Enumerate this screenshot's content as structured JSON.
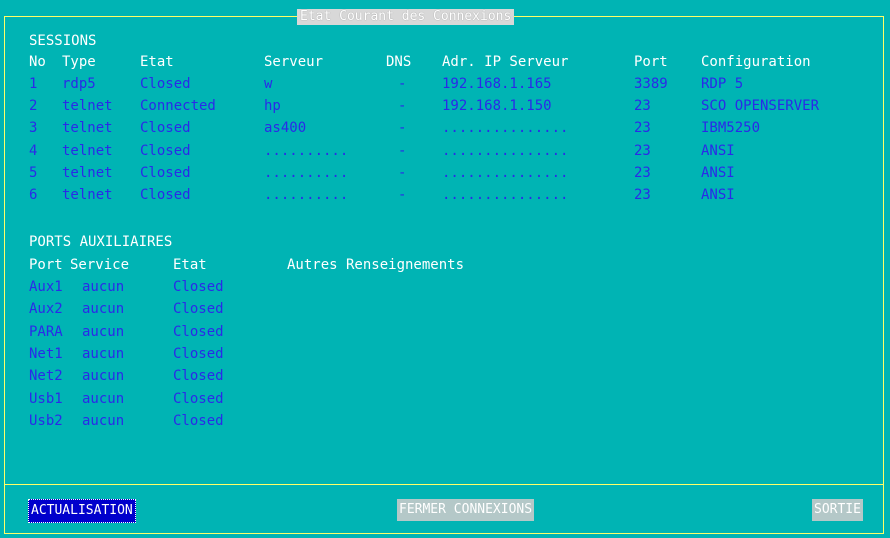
{
  "window": {
    "title": "Etat Courant des Connexions"
  },
  "sessions": {
    "heading": "SESSIONS",
    "headers": {
      "no": "No",
      "type": "Type",
      "etat": "Etat",
      "serveur": "Serveur",
      "dns": "DNS",
      "ip": "Adr. IP Serveur",
      "port": "Port",
      "config": "Configuration"
    },
    "rows": [
      {
        "no": "1",
        "type": "rdp5",
        "etat": "Closed",
        "serveur": "w",
        "dns": "-",
        "ip": "192.168.1.165",
        "port": "3389",
        "config": "RDP 5"
      },
      {
        "no": "2",
        "type": "telnet",
        "etat": "Connected",
        "serveur": "hp",
        "dns": "-",
        "ip": "192.168.1.150",
        "port": "23",
        "config": "SCO OPENSERVER"
      },
      {
        "no": "3",
        "type": "telnet",
        "etat": "Closed",
        "serveur": "as400",
        "dns": "-",
        "ip": "...............",
        "port": "23",
        "config": "IBM5250"
      },
      {
        "no": "4",
        "type": "telnet",
        "etat": "Closed",
        "serveur": "..........",
        "dns": "-",
        "ip": "...............",
        "port": "23",
        "config": "ANSI"
      },
      {
        "no": "5",
        "type": "telnet",
        "etat": "Closed",
        "serveur": "..........",
        "dns": "-",
        "ip": "...............",
        "port": "23",
        "config": "ANSI"
      },
      {
        "no": "6",
        "type": "telnet",
        "etat": "Closed",
        "serveur": "..........",
        "dns": "-",
        "ip": "...............",
        "port": "23",
        "config": "ANSI"
      }
    ]
  },
  "aux": {
    "heading": "PORTS AUXILIAIRES",
    "headers": {
      "port": "Port",
      "service": "Service",
      "etat": "Etat",
      "autres": "Autres Renseignements"
    },
    "rows": [
      {
        "port": "Aux1",
        "service": "aucun",
        "etat": "Closed"
      },
      {
        "port": "Aux2",
        "service": "aucun",
        "etat": "Closed"
      },
      {
        "port": "PARA",
        "service": "aucun",
        "etat": "Closed"
      },
      {
        "port": "Net1",
        "service": "aucun",
        "etat": "Closed"
      },
      {
        "port": "Net2",
        "service": "aucun",
        "etat": "Closed"
      },
      {
        "port": "Usb1",
        "service": "aucun",
        "etat": "Closed"
      },
      {
        "port": "Usb2",
        "service": "aucun",
        "etat": "Closed"
      }
    ]
  },
  "buttons": {
    "refresh": "ACTUALISATION",
    "close_connections": "FERMER CONNEXIONS",
    "exit": "SORTIE"
  },
  "colors": {
    "background": "#00b4b4",
    "frame": "#ffff66",
    "value_text": "#2a2ae8",
    "label_text": "#ffffff",
    "focus_button": "#0000cc"
  }
}
